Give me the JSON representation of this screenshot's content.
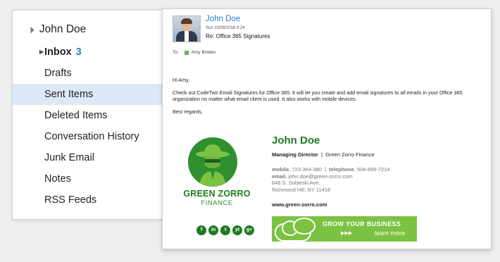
{
  "folders": {
    "account": "John Doe",
    "items": [
      {
        "label": "Inbox",
        "count": "3"
      },
      {
        "label": "Drafts"
      },
      {
        "label": "Sent Items"
      },
      {
        "label": "Deleted Items"
      },
      {
        "label": "Conversation History"
      },
      {
        "label": "Junk Email"
      },
      {
        "label": "Notes"
      },
      {
        "label": "RSS Feeds"
      }
    ]
  },
  "message": {
    "sender": "John Doe",
    "date": "Sun 10/09/2016 8:24",
    "subject": "Re: Office 365 Signatures",
    "to_label": "To:",
    "to_name": "Amy Bolden",
    "greeting": "Hi Amy,",
    "body": "Check out CodeTwo Email Signatures for Office 365. It will let you create and add email signatures to all emails in your Office 365 organization no matter what email client is used. It also works with mobile devices.",
    "closing": "Best regards,"
  },
  "signature": {
    "name": "John Doe",
    "role": "Managing Director",
    "separator": "|",
    "company": "Green Zorro Finance",
    "mobile_label": "mobile.",
    "mobile": "723-364-380",
    "pipe": "|",
    "telephone_label": "telephone.",
    "telephone": "504-899-7214",
    "email_label": "email.",
    "email": "john.doe@green-zorro.com",
    "address1": "648 S. Sobieski Ave.",
    "address2": "Richmond Hill, NY 11418",
    "website": "www.green-zorro.com",
    "logo_name": "GREEN ZORRO",
    "logo_sub": "FINANCE",
    "social": [
      "f",
      "in",
      "t",
      "yt",
      "g+"
    ],
    "banner_title": "GROW YOUR BUSINESS",
    "banner_arrows": "▶▶▶",
    "banner_link": "learn more"
  },
  "colors": {
    "accent_blue": "#2a7bd1",
    "brand_green": "#1f7a1f",
    "banner_green": "#7cc242",
    "selected_bg": "#dde9f7"
  }
}
